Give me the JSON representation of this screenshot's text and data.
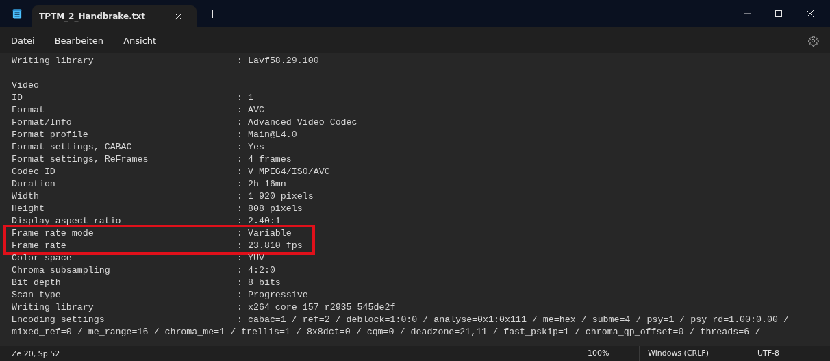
{
  "tab": {
    "title": "TPTM_2_Handbrake.txt",
    "selected": true
  },
  "menu": [
    "Datei",
    "Bearbeiten",
    "Ansicht"
  ],
  "lines": [
    {
      "kind": "field",
      "key": "Writing library",
      "value": ": Lavf58.29.100",
      "highlighted": false
    },
    {
      "kind": "blank"
    },
    {
      "kind": "heading",
      "text": "Video"
    },
    {
      "kind": "field",
      "key": "ID",
      "value": ": 1",
      "highlighted": false
    },
    {
      "kind": "field",
      "key": "Format",
      "value": ": AVC",
      "highlighted": false
    },
    {
      "kind": "field",
      "key": "Format/Info",
      "value": ": Advanced Video Codec",
      "highlighted": false
    },
    {
      "kind": "field",
      "key": "Format profile",
      "value": ": Main@L4.0",
      "highlighted": false
    },
    {
      "kind": "field",
      "key": "Format settings, CABAC",
      "value": ": Yes",
      "highlighted": false
    },
    {
      "kind": "field",
      "key": "Format settings, ReFrames",
      "value": ": 4 frames",
      "highlighted": false,
      "caret": true
    },
    {
      "kind": "field",
      "key": "Codec ID",
      "value": ": V_MPEG4/ISO/AVC",
      "highlighted": false
    },
    {
      "kind": "field",
      "key": "Duration",
      "value": ": 2h 16mn",
      "highlighted": false
    },
    {
      "kind": "field",
      "key": "Width",
      "value": ": 1 920 pixels",
      "highlighted": false
    },
    {
      "kind": "field",
      "key": "Height",
      "value": ": 808 pixels",
      "highlighted": false
    },
    {
      "kind": "field",
      "key": "Display aspect ratio",
      "value": ": 2.40:1",
      "highlighted": false
    },
    {
      "kind": "field",
      "key": "Frame rate mode",
      "value": ": Variable",
      "highlighted": true
    },
    {
      "kind": "field",
      "key": "Frame rate",
      "value": ": 23.810 fps",
      "highlighted": true
    },
    {
      "kind": "field",
      "key": "Color space",
      "value": ": YUV",
      "highlighted": false
    },
    {
      "kind": "field",
      "key": "Chroma subsampling",
      "value": ": 4:2:0",
      "highlighted": false
    },
    {
      "kind": "field",
      "key": "Bit depth",
      "value": ": 8 bits",
      "highlighted": false
    },
    {
      "kind": "field",
      "key": "Scan type",
      "value": ": Progressive",
      "highlighted": false
    },
    {
      "kind": "field",
      "key": "Writing library",
      "value": ": x264 core 157 r2935 545de2f",
      "highlighted": false
    },
    {
      "kind": "field",
      "key": "Encoding settings",
      "value": ": cabac=1 / ref=2 / deblock=1:0:0 / analyse=0x1:0x111 / me=hex / subme=4 / psy=1 / psy_rd=1.00:0.00 /",
      "highlighted": false
    },
    {
      "kind": "wrap",
      "text": "mixed_ref=0 / me_range=16 / chroma_me=1 / trellis=1 / 8x8dct=0 / cqm=0 / deadzone=21,11 / fast_pskip=1 / chroma_qp_offset=0 / threads=6 /"
    }
  ],
  "status_bar": {
    "position": "Ze 20, Sp 52",
    "zoom": "100%",
    "line_ending": "Windows (CRLF)",
    "encoding": "UTF-8"
  }
}
